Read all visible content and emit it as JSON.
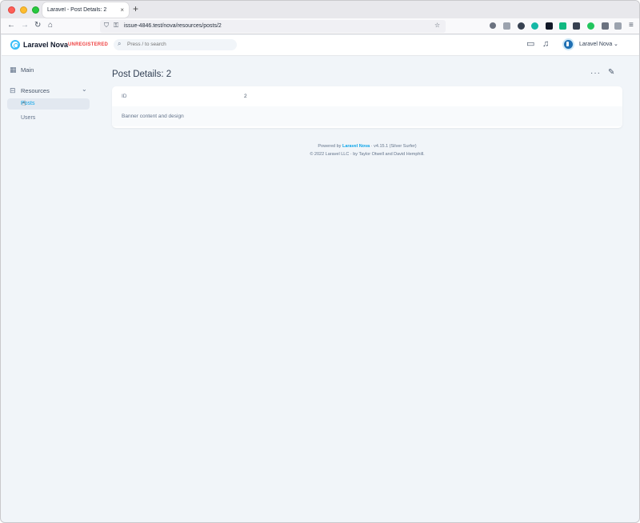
{
  "browser": {
    "tab_title": "Laravel - Post Details: 2",
    "tab_close": "×",
    "new_tab": "+",
    "url": "issue-4846.test/nova/resources/posts/2"
  },
  "colors": {
    "accent": "#38bdf8",
    "unregistered": "#ef4444",
    "link": "#0ea5e9",
    "background": "#f1f5f9"
  },
  "header": {
    "brand": "Laravel Nova",
    "badge": "UNREGISTERED",
    "search_placeholder": "Press / to search",
    "user_name": "Laravel Nova"
  },
  "sidebar": {
    "main_label": "Main",
    "resources_label": "Resources",
    "items": [
      {
        "label": "Posts",
        "active": true
      },
      {
        "label": "Users",
        "active": false
      }
    ]
  },
  "page": {
    "title": "Post Details: 2",
    "fields": [
      {
        "label": "ID",
        "value": "2"
      },
      {
        "label": "Banner content and design",
        "value": ""
      }
    ]
  },
  "footer": {
    "powered_prefix": "Powered by ",
    "powered_link": "Laravel Nova",
    "powered_suffix": " · v4.15.1 (Silver Surfer)",
    "copyright": "© 2022 Laravel LLC · by Taylor Otwell and David Hemphill."
  }
}
